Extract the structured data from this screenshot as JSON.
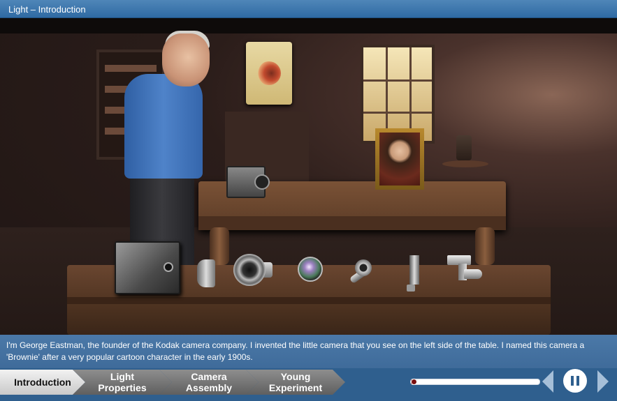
{
  "window": {
    "title": "Light – Introduction"
  },
  "narration": {
    "text": "I'm George Eastman, the founder of the Kodak camera company. I invented the little camera that you see on the left side of the table. I named this camera a 'Brownie' after a very popular cartoon character in the early 1900s."
  },
  "tabs": [
    {
      "label": "Introduction",
      "line1": "Introduction",
      "line2": "",
      "active": true
    },
    {
      "label": "Light Properties",
      "line1": "Light",
      "line2": "Properties",
      "active": false
    },
    {
      "label": "Camera Assembly",
      "line1": "Camera",
      "line2": "Assembly",
      "active": false
    },
    {
      "label": "Young Experiment",
      "line1": "Young",
      "line2": "Experiment",
      "active": false
    }
  ],
  "player": {
    "progress_fraction": 0.02,
    "state_icon": "pause-icon",
    "prev_icon": "previous-icon",
    "next_icon": "next-icon"
  },
  "scene": {
    "camera_parts": [
      "brownie-camera",
      "shutter",
      "lens-barrel",
      "lens",
      "knob",
      "bracket",
      "viewfinder"
    ]
  },
  "colors": {
    "title_bar": "#2f6aa3",
    "caption_bg": "#4b79a8",
    "nav_bg": "#2f5f8e",
    "tab_active": "#e6e6e6",
    "tab_inactive": "#7a7a7a",
    "progress_fill": "#7a0f0f",
    "nav_arrow": "#a6bfd8"
  }
}
